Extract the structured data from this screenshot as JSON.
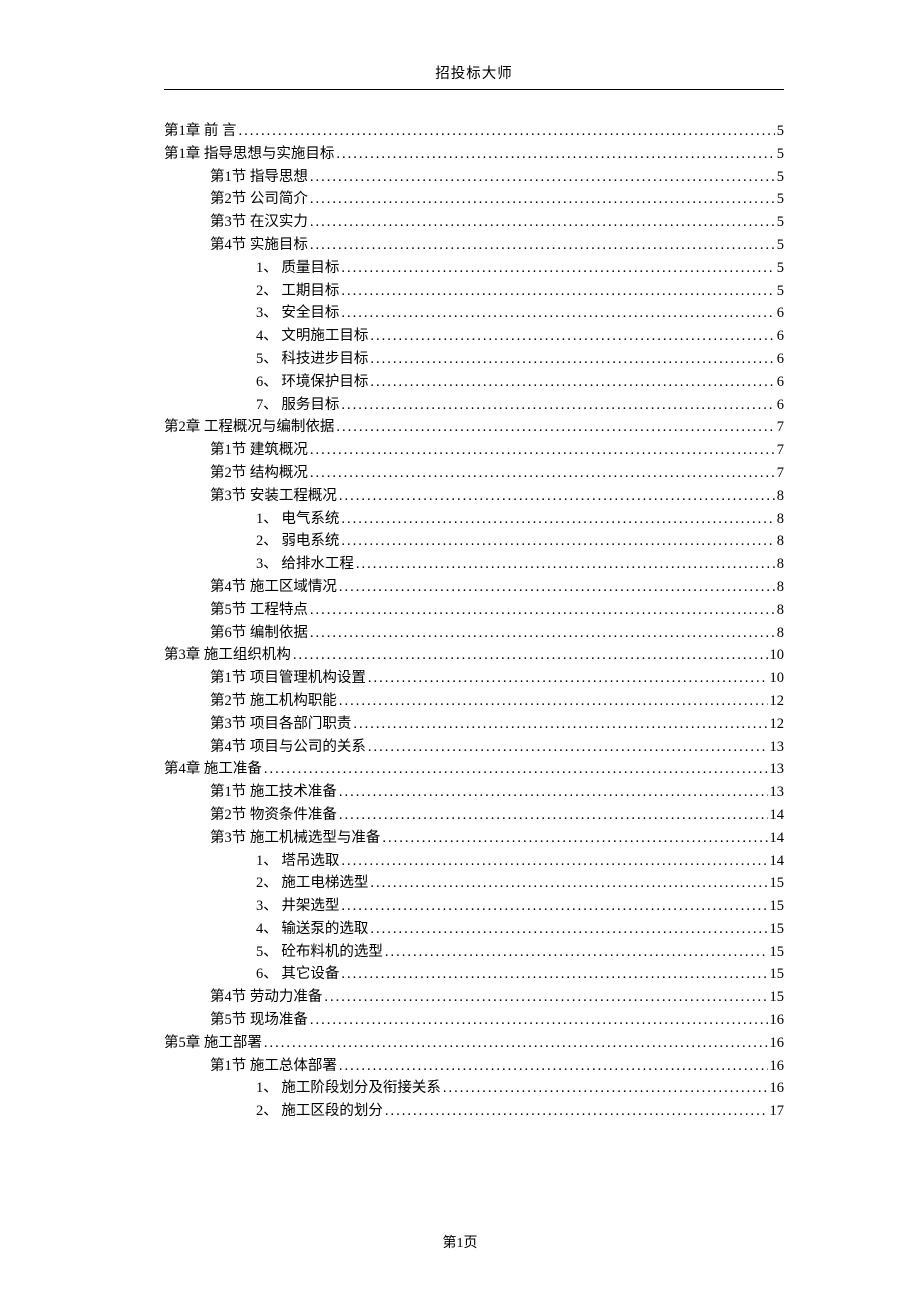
{
  "header": "招投标大师",
  "footer": "第1页",
  "toc": [
    {
      "label": "第1章 前   言",
      "page": "5",
      "indent": 0
    },
    {
      "label": "第1章 指导思想与实施目标",
      "page": "5",
      "indent": 0
    },
    {
      "label": "第1节 指导思想",
      "page": "5",
      "indent": 1
    },
    {
      "label": "第2节 公司简介",
      "page": "5",
      "indent": 1
    },
    {
      "label": "第3节 在汉实力",
      "page": "5",
      "indent": 1
    },
    {
      "label": "第4节 实施目标",
      "page": "5",
      "indent": 1
    },
    {
      "label": "1、 质量目标",
      "page": "5",
      "indent": 2
    },
    {
      "label": "2、 工期目标",
      "page": "5",
      "indent": 2
    },
    {
      "label": "3、 安全目标",
      "page": "6",
      "indent": 2
    },
    {
      "label": "4、 文明施工目标",
      "page": "6",
      "indent": 2
    },
    {
      "label": "5、 科技进步目标",
      "page": "6",
      "indent": 2
    },
    {
      "label": "6、 环境保护目标",
      "page": "6",
      "indent": 2
    },
    {
      "label": "7、 服务目标",
      "page": "6",
      "indent": 2
    },
    {
      "label": "第2章 工程概况与编制依据",
      "page": "7",
      "indent": 0
    },
    {
      "label": "第1节 建筑概况",
      "page": "7",
      "indent": 1
    },
    {
      "label": "第2节 结构概况",
      "page": "7",
      "indent": 1
    },
    {
      "label": "第3节 安装工程概况",
      "page": "8",
      "indent": 1
    },
    {
      "label": "1、 电气系统",
      "page": "8",
      "indent": 2
    },
    {
      "label": "2、 弱电系统",
      "page": "8",
      "indent": 2
    },
    {
      "label": "3、 给排水工程",
      "page": "8",
      "indent": 2
    },
    {
      "label": "第4节 施工区域情况",
      "page": "8",
      "indent": 1
    },
    {
      "label": "第5节 工程特点",
      "page": "8",
      "indent": 1
    },
    {
      "label": "第6节 编制依据",
      "page": "8",
      "indent": 1
    },
    {
      "label": "第3章 施工组织机构 ",
      "page": "10",
      "indent": 0
    },
    {
      "label": "第1节 项目管理机构设置",
      "page": "10",
      "indent": 1
    },
    {
      "label": "第2节 施工机构职能",
      "page": "12",
      "indent": 1
    },
    {
      "label": "第3节 项目各部门职责",
      "page": "12",
      "indent": 1
    },
    {
      "label": "第4节 项目与公司的关系",
      "page": "13",
      "indent": 1
    },
    {
      "label": "第4章 施工准备",
      "page": "13",
      "indent": 0
    },
    {
      "label": "第1节 施工技术准备",
      "page": "13",
      "indent": 1
    },
    {
      "label": "第2节 物资条件准备",
      "page": "14",
      "indent": 1
    },
    {
      "label": "第3节 施工机械选型与准备",
      "page": "14",
      "indent": 1
    },
    {
      "label": "1、 塔吊选取",
      "page": "14",
      "indent": 2
    },
    {
      "label": "2、 施工电梯选型",
      "page": "15",
      "indent": 2
    },
    {
      "label": "3、 井架选型",
      "page": "15",
      "indent": 2
    },
    {
      "label": "4、 输送泵的选取",
      "page": "15",
      "indent": 2
    },
    {
      "label": "5、 砼布料机的选型",
      "page": "15",
      "indent": 2
    },
    {
      "label": "6、 其它设备",
      "page": "15",
      "indent": 2
    },
    {
      "label": "第4节 劳动力准备",
      "page": "15",
      "indent": 1
    },
    {
      "label": "第5节 现场准备",
      "page": "16",
      "indent": 1
    },
    {
      "label": "第5章 施工部署",
      "page": "16",
      "indent": 0
    },
    {
      "label": "第1节 施工总体部署",
      "page": "16",
      "indent": 1
    },
    {
      "label": "1、 施工阶段划分及衔接关系",
      "page": "16",
      "indent": 2
    },
    {
      "label": "2、 施工区段的划分",
      "page": "17",
      "indent": 2
    }
  ]
}
